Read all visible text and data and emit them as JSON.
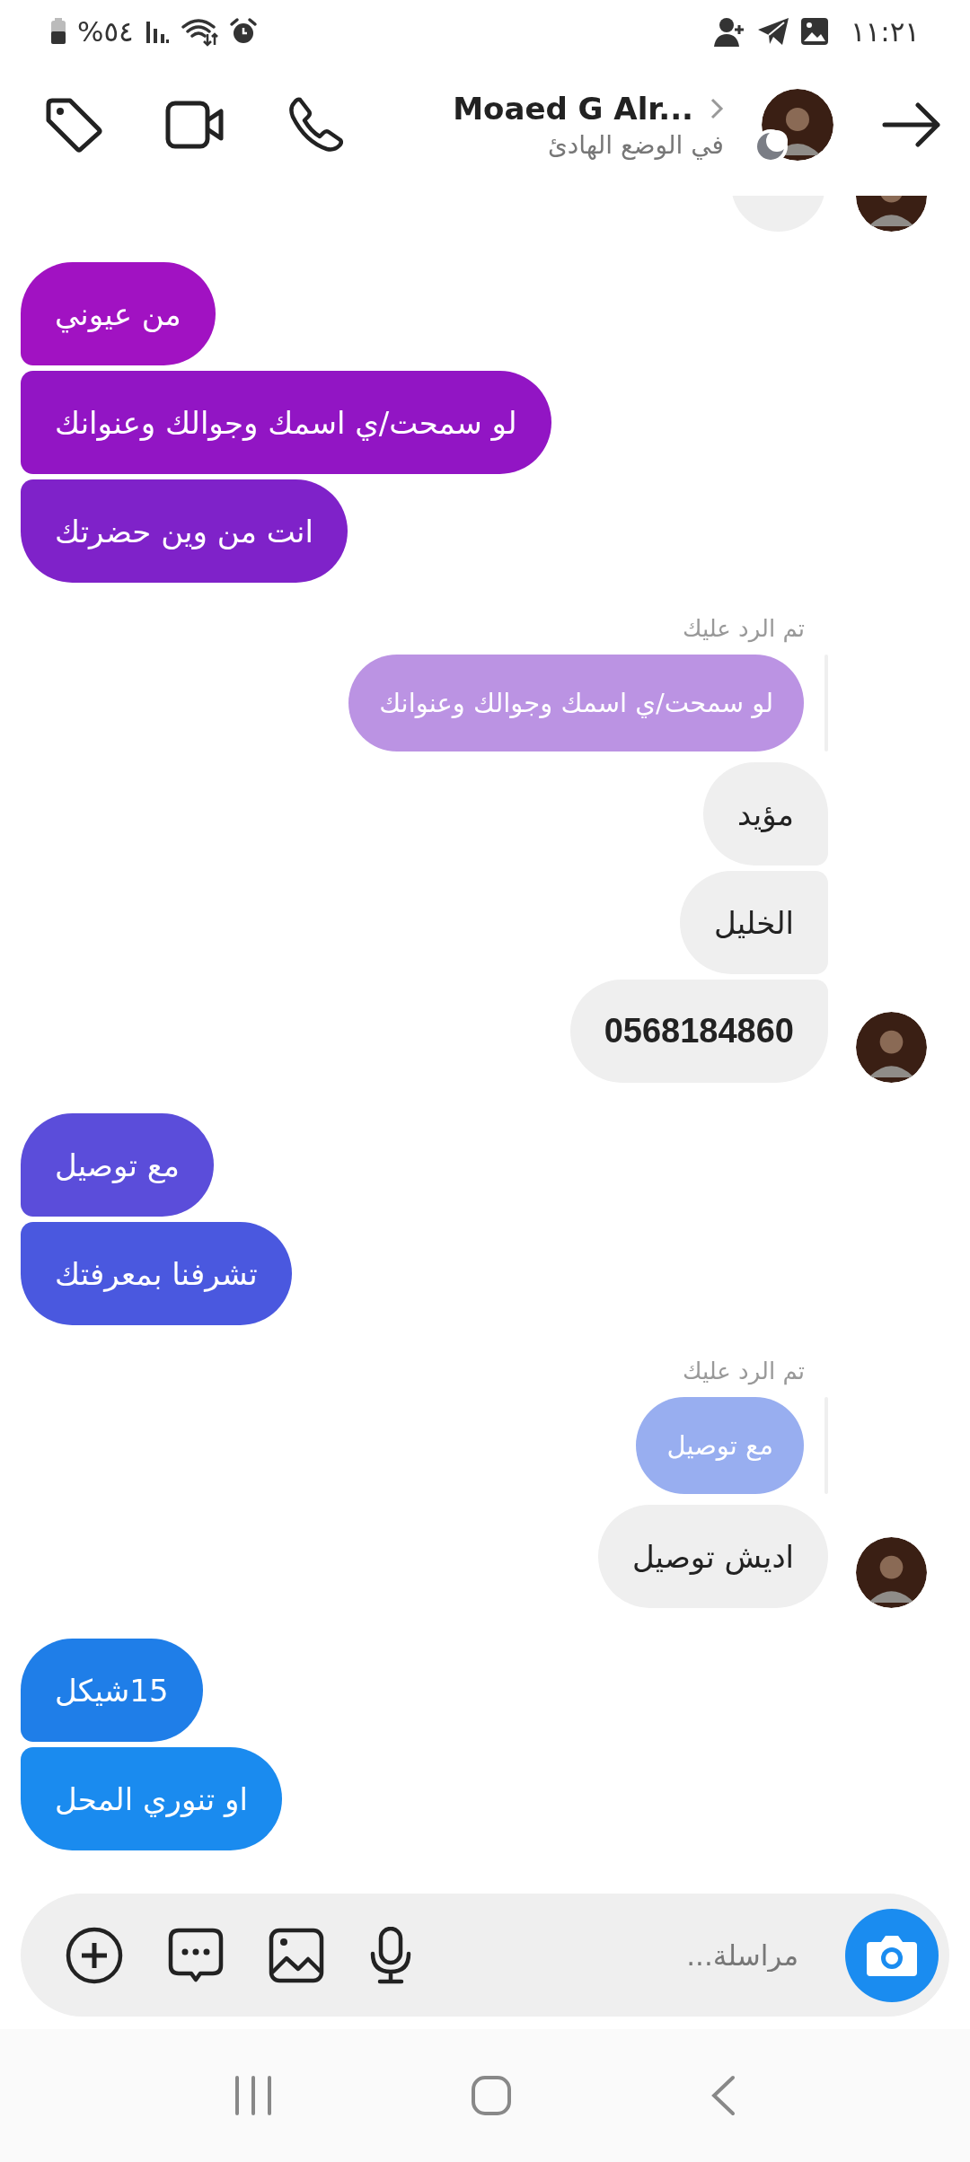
{
  "status_bar": {
    "battery": "%٥٤",
    "time": "١١:٢١"
  },
  "header": {
    "name": "Moaed G Alr...",
    "status": "في الوضع الهادئ"
  },
  "messages": [
    {
      "kind": "partial",
      "avatar": true
    },
    {
      "kind": "sent",
      "text": "من عيوني",
      "color": "#a112c2"
    },
    {
      "kind": "sent",
      "text": "لو سمحت/ي اسمك وجوالك وعنوانك",
      "color": "#9215c4"
    },
    {
      "kind": "sent",
      "text": "انت من وين حضرتك",
      "color": "#7f22c9"
    },
    {
      "kind": "reply_label",
      "text": "تم الرد عليك"
    },
    {
      "kind": "quote",
      "text": "لو سمحت/ي اسمك وجوالك وعنوانك",
      "color": "#bb93e3"
    },
    {
      "kind": "received",
      "text": "مؤيد",
      "avatar": false,
      "link": false
    },
    {
      "kind": "received",
      "text": "الخليل",
      "avatar": false,
      "link": false
    },
    {
      "kind": "received",
      "text": "0568184860",
      "avatar": true,
      "link": true
    },
    {
      "kind": "sent",
      "text": "مع توصيل",
      "color": "#5b4dda"
    },
    {
      "kind": "sent",
      "text": "تشرفنا بمعرفتك",
      "color": "#4a58df"
    },
    {
      "kind": "reply_label",
      "text": "تم الرد عليك"
    },
    {
      "kind": "quote",
      "text": "مع توصيل",
      "color": "#98aef0"
    },
    {
      "kind": "received",
      "text": "اديش توصيل",
      "avatar": true,
      "link": false
    },
    {
      "kind": "sent",
      "text": "15شيكل",
      "color": "#1f7ee8"
    },
    {
      "kind": "sent",
      "text": "او تنوري المحل",
      "color": "#1a8bef"
    }
  ],
  "composer": {
    "placeholder": "مراسلة..."
  }
}
